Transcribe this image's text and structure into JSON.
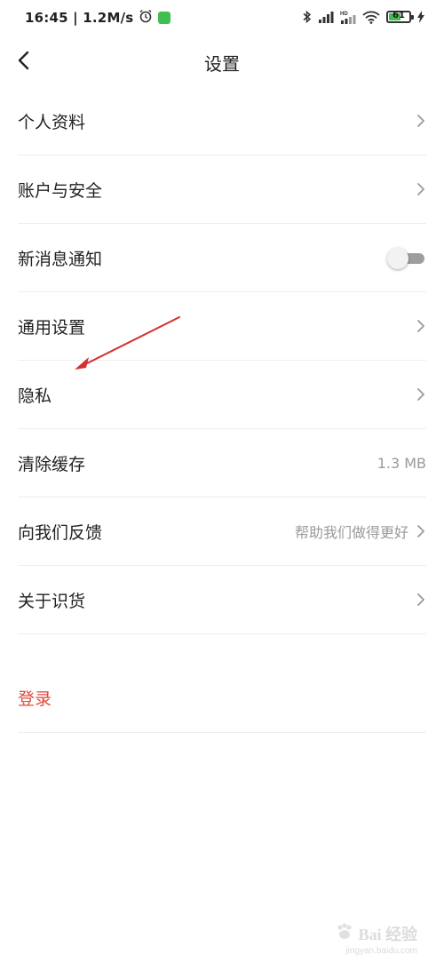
{
  "status_bar": {
    "time_speed": "16:45 | 1.2M/s",
    "battery_level": "61",
    "battery_percent": 61,
    "icons": [
      "alarm-icon",
      "app-notification-icon",
      "bluetooth-icon",
      "signal-icon",
      "hd-signal-icon",
      "wifi-icon",
      "battery-icon",
      "charging-icon"
    ],
    "colors": {
      "battery": "#3fbf4f",
      "app_icon": "#3fbf4f"
    }
  },
  "nav": {
    "title": "设置",
    "back_icon": "chevron-left-icon"
  },
  "settings": {
    "items": [
      {
        "label": "个人资料",
        "trailing": "chevron"
      },
      {
        "label": "账户与安全",
        "trailing": "chevron"
      },
      {
        "label": "新消息通知",
        "trailing": "toggle",
        "toggle_on": false
      },
      {
        "label": "通用设置",
        "trailing": "chevron"
      },
      {
        "label": "隐私",
        "trailing": "chevron"
      },
      {
        "label": "清除缓存",
        "trailing": "value",
        "value": "1.3 MB"
      },
      {
        "label": "向我们反馈",
        "trailing": "value-chevron",
        "value": "帮助我们做得更好"
      },
      {
        "label": "关于识货",
        "trailing": "chevron"
      }
    ]
  },
  "login": {
    "label": "登录",
    "color": "#e24a3b"
  },
  "annotation": {
    "color": "#d32f2f",
    "icon": "red-arrow-annotation"
  },
  "watermark": {
    "text": "Bai 经验",
    "sub": "jingyan.baidu.com"
  }
}
